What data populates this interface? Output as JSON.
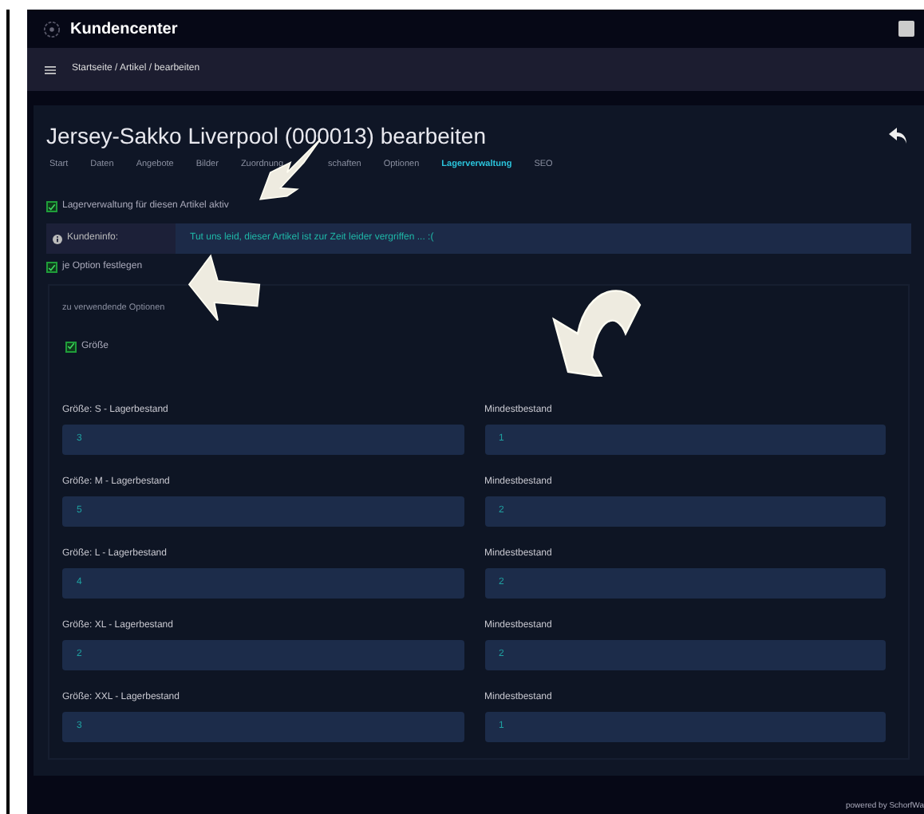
{
  "header": {
    "title": "Kundencenter"
  },
  "breadcrumb": "Startseite / Artikel / bearbeiten",
  "page_title": "Jersey-Sakko Liverpool (000013) bearbeiten",
  "tabs": [
    {
      "label": "Start",
      "selected": false
    },
    {
      "label": "Daten",
      "selected": false
    },
    {
      "label": "Angebote",
      "selected": false
    },
    {
      "label": "Bilder",
      "selected": false
    },
    {
      "label": "Zuordnung",
      "selected": false
    },
    {
      "label": "schaften",
      "selected": false
    },
    {
      "label": "Optionen",
      "selected": false
    },
    {
      "label": "Lagerverwaltung",
      "selected": true
    },
    {
      "label": "SEO",
      "selected": false
    }
  ],
  "stock_active": {
    "label": "Lagerverwaltung für diesen Artikel aktiv",
    "checked": true
  },
  "customer_info": {
    "label": "Kundeninfo:",
    "value": "Tut uns leid, dieser Artikel ist zur Zeit leider vergriffen ... :("
  },
  "per_option": {
    "label": "je Option festlegen",
    "checked": true
  },
  "options_heading": "zu verwendende Optionen",
  "options": [
    {
      "label": "Größe",
      "checked": true
    }
  ],
  "stock_rows": [
    {
      "stock_label": "Größe: S - Lagerbestand",
      "stock": "3",
      "min_label": "Mindestbestand",
      "min": "1"
    },
    {
      "stock_label": "Größe: M - Lagerbestand",
      "stock": "5",
      "min_label": "Mindestbestand",
      "min": "2"
    },
    {
      "stock_label": "Größe: L - Lagerbestand",
      "stock": "4",
      "min_label": "Mindestbestand",
      "min": "2"
    },
    {
      "stock_label": "Größe: XL - Lagerbestand",
      "stock": "2",
      "min_label": "Mindestbestand",
      "min": "2"
    },
    {
      "stock_label": "Größe: XXL - Lagerbestand",
      "stock": "3",
      "min_label": "Mindestbestand",
      "min": "1"
    }
  ],
  "footer": "powered by SchorfWa"
}
